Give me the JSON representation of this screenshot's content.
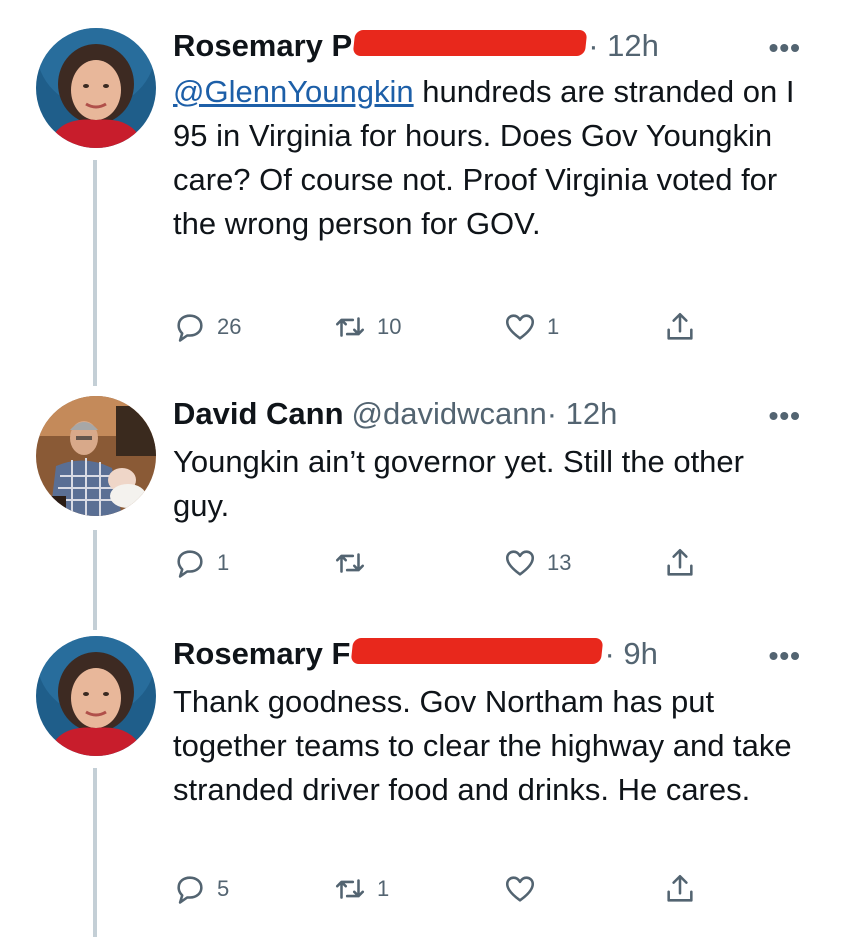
{
  "tweets": [
    {
      "name": "Rosemary P",
      "handle": "",
      "time": "· 12h",
      "mention": "@GlennYoungkin",
      "text": " hundreds are stranded on I 95 in Virginia for hours. Does Gov Youngkin care? Of course not. Proof Virginia voted for the wrong person for GOV.",
      "more": "•••",
      "replies": "26",
      "retweets": "10",
      "likes": "1"
    },
    {
      "name": "David Cann",
      "handle": "@davidwcann",
      "time": "· 12h",
      "mention": "",
      "text": "Youngkin ain’t governor yet. Still the other guy.",
      "more": "•••",
      "replies": "1",
      "retweets": "",
      "likes": "13"
    },
    {
      "name": "Rosemary F",
      "handle": "",
      "time": "· 9h",
      "mention": "",
      "text": "Thank goodness.  Gov Northam has put together teams to clear the highway and take stranded driver food and drinks.  He cares.",
      "more": "•••",
      "replies": "5",
      "retweets": "1",
      "likes": ""
    }
  ],
  "icons": {
    "reply": "reply-icon",
    "retweet": "retweet-icon",
    "like": "heart-icon",
    "share": "share-icon",
    "more": "more-icon"
  },
  "colors": {
    "redaction": "#e8281c",
    "mention": "#1d5fa8",
    "muted": "#536471",
    "thread_line": "#c4cfd6"
  }
}
